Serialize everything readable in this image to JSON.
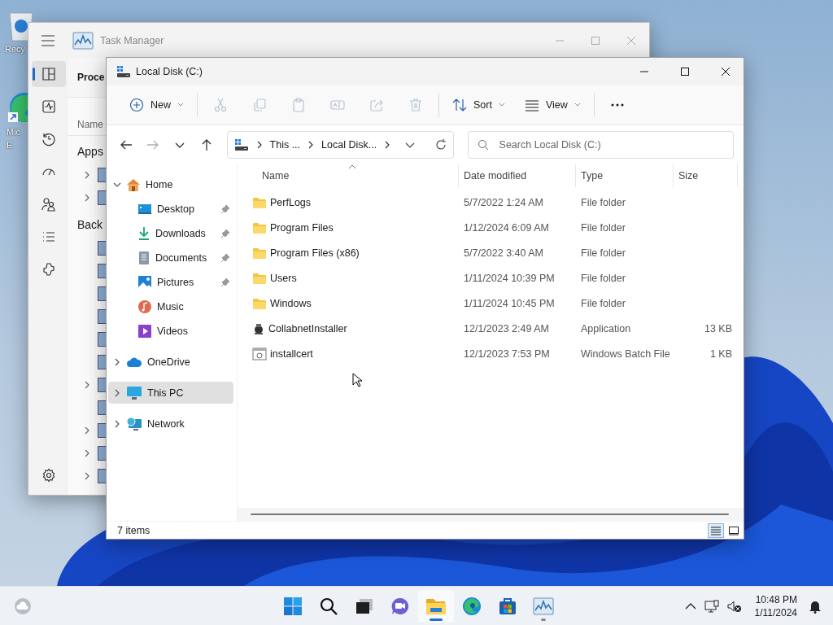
{
  "desktop": {
    "icons": [
      {
        "kind": "recycle",
        "shortcut": false,
        "label_lines": [
          "Recy"
        ]
      },
      {
        "kind": "edge",
        "shortcut": true,
        "label_lines": [
          "Mic",
          "E"
        ]
      }
    ]
  },
  "task_manager": {
    "title": "Task Manager",
    "nav": [
      {
        "kind": "processes",
        "selected": true
      },
      {
        "kind": "performance",
        "selected": false
      },
      {
        "kind": "history",
        "selected": false
      },
      {
        "kind": "startup",
        "selected": false
      },
      {
        "kind": "users",
        "selected": false
      },
      {
        "kind": "details",
        "selected": false
      },
      {
        "kind": "services",
        "selected": false
      }
    ],
    "nav_bottom": [
      {
        "kind": "settings",
        "selected": false
      }
    ],
    "header": "Proce",
    "column": "Name",
    "groups": [
      {
        "title": "Apps",
        "rows": [
          {
            "expandable": true
          },
          {
            "expandable": true
          }
        ]
      },
      {
        "title": "Back",
        "rows": [
          {
            "expandable": false
          },
          {
            "expandable": false
          },
          {
            "expandable": false
          },
          {
            "expandable": false
          },
          {
            "expandable": false
          },
          {
            "expandable": false
          },
          {
            "expandable": true
          },
          {
            "expandable": false
          },
          {
            "expandable": true
          },
          {
            "expandable": true
          },
          {
            "expandable": true
          }
        ]
      }
    ]
  },
  "explorer": {
    "title": "Local Disk (C:)",
    "toolbar": [
      [
        {
          "kind": "new",
          "label": "New",
          "disabled": false
        }
      ],
      [
        {
          "kind": "cut",
          "disabled": true
        },
        {
          "kind": "copy",
          "disabled": true
        },
        {
          "kind": "paste",
          "disabled": true
        },
        {
          "kind": "rename",
          "disabled": true
        },
        {
          "kind": "share",
          "disabled": true
        },
        {
          "kind": "delete",
          "disabled": true
        }
      ],
      [
        {
          "kind": "sort",
          "label": "Sort",
          "disabled": false
        },
        {
          "kind": "view",
          "label": "View",
          "disabled": false
        }
      ],
      [
        {
          "kind": "more",
          "disabled": false
        }
      ]
    ],
    "nav_buttons": [
      {
        "kind": "back",
        "disabled": false
      },
      {
        "kind": "forward",
        "disabled": true
      },
      {
        "kind": "recent",
        "disabled": false
      },
      {
        "kind": "up",
        "disabled": false
      }
    ],
    "address": {
      "crumbs": [
        "This ...",
        "Local Disk..."
      ]
    },
    "search": {
      "placeholder": "Search Local Disk (C:)"
    },
    "sidebar": [
      {
        "label": "Home",
        "kind": "home",
        "expanded": true,
        "selected": false,
        "children": [
          {
            "label": "Desktop",
            "kind": "desktop",
            "pinned": true,
            "selected": false
          },
          {
            "label": "Downloads",
            "kind": "downloads",
            "pinned": true,
            "selected": false
          },
          {
            "label": "Documents",
            "kind": "documents",
            "pinned": true,
            "selected": false
          },
          {
            "label": "Pictures",
            "kind": "pictures",
            "pinned": true,
            "selected": false
          },
          {
            "label": "Music",
            "kind": "music",
            "pinned": false,
            "selected": false
          },
          {
            "label": "Videos",
            "kind": "videos",
            "pinned": false,
            "selected": false
          }
        ]
      },
      {
        "label": "OneDrive",
        "kind": "onedrive",
        "expanded": false,
        "selected": false
      },
      {
        "label": "This PC",
        "kind": "pc",
        "expanded": false,
        "selected": true
      },
      {
        "label": "Network",
        "kind": "network",
        "expanded": false,
        "selected": false
      }
    ],
    "columns": [
      {
        "label": "Name",
        "sorted": true
      },
      {
        "label": "Date modified",
        "sorted": false
      },
      {
        "label": "Type",
        "sorted": false
      },
      {
        "label": "Size",
        "sorted": false
      }
    ],
    "files": [
      {
        "name": "PerfLogs",
        "kind": "folder",
        "date": "5/7/2022 1:24 AM",
        "type": "File folder"
      },
      {
        "name": "Program Files",
        "kind": "folder",
        "date": "1/12/2024 6:09 AM",
        "type": "File folder"
      },
      {
        "name": "Program Files (x86)",
        "kind": "folder",
        "date": "5/7/2022 3:40 AM",
        "type": "File folder"
      },
      {
        "name": "Users",
        "kind": "folder",
        "date": "1/11/2024 10:39 PM",
        "type": "File folder"
      },
      {
        "name": "Windows",
        "kind": "folder",
        "date": "1/11/2024 10:45 PM",
        "type": "File folder"
      },
      {
        "name": "CollabnetInstaller",
        "kind": "application",
        "date": "12/1/2023 2:49 AM",
        "type": "Application",
        "size": "13 KB"
      },
      {
        "name": "installcert",
        "kind": "batch",
        "date": "12/1/2023 7:53 PM",
        "type": "Windows Batch File",
        "size": "1 KB"
      }
    ],
    "status": "7 items",
    "view_modes": [
      {
        "kind": "details",
        "selected": true
      },
      {
        "kind": "tiles",
        "selected": false
      }
    ]
  },
  "taskbar": {
    "apps": [
      {
        "kind": "start",
        "selected": false,
        "running": false
      },
      {
        "kind": "search",
        "selected": false,
        "running": false
      },
      {
        "kind": "taskview",
        "selected": false,
        "running": false
      },
      {
        "kind": "chat",
        "selected": false,
        "running": false
      },
      {
        "kind": "explorer",
        "selected": true,
        "running": true
      },
      {
        "kind": "edge",
        "selected": false,
        "running": false
      },
      {
        "kind": "store",
        "selected": false,
        "running": false
      },
      {
        "kind": "taskmanager",
        "selected": false,
        "running": true
      }
    ],
    "time": "10:48 PM",
    "date": "1/11/2024"
  }
}
